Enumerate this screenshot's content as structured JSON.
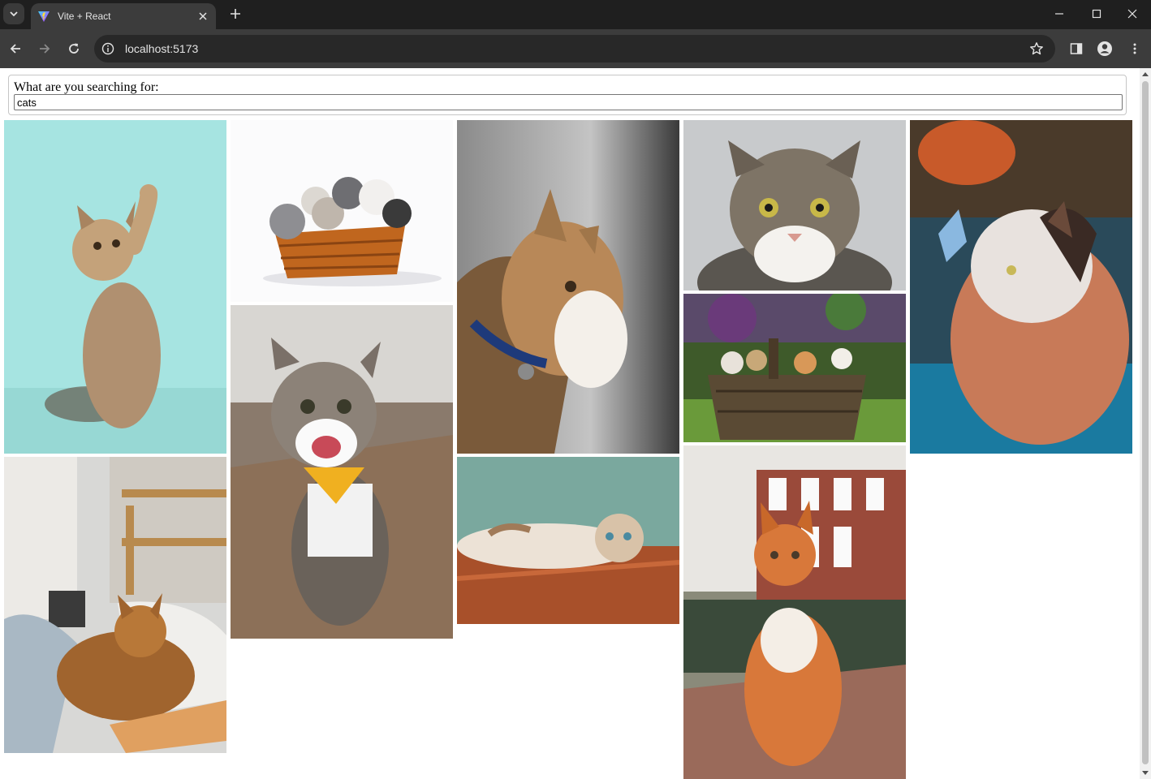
{
  "browser": {
    "tab_title": "Vite + React",
    "url": "localhost:5173"
  },
  "icons": {
    "tab_search": "chevron-down-icon",
    "close": "close-icon",
    "new_tab": "plus-icon",
    "back": "arrow-left-icon",
    "forward": "arrow-right-icon",
    "reload": "reload-icon",
    "site_info": "info-icon",
    "bookmark": "star-icon",
    "side_panel": "side-panel-icon",
    "profile": "profile-icon",
    "menu": "kebab-menu-icon"
  },
  "search": {
    "label": "What are you searching for:",
    "value": "cats"
  },
  "gallery": {
    "photos": [
      {
        "name": "kitten-raising-paw"
      },
      {
        "name": "kittens-in-basket"
      },
      {
        "name": "cat-with-blue-collar-profile"
      },
      {
        "name": "tabby-cat-portrait"
      },
      {
        "name": "cat-with-butterfly"
      },
      {
        "name": "cat-sleeping-in-bed"
      },
      {
        "name": "happy-cat-with-bandana"
      },
      {
        "name": "kittens-in-wooden-basket"
      },
      {
        "name": "cat-lying-on-floor"
      },
      {
        "name": "orange-cat-on-street"
      }
    ]
  }
}
